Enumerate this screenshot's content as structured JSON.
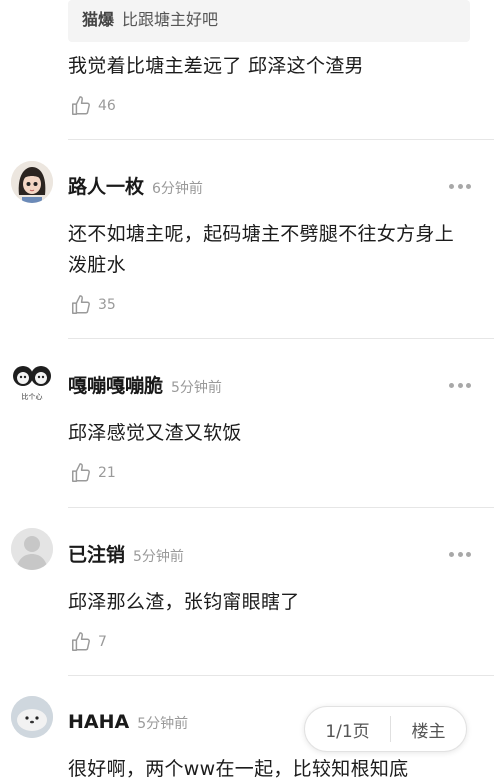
{
  "quote": {
    "author": "猫爆",
    "text": "比跟塘主好吧"
  },
  "top_comment": {
    "text": "我觉着比塘主差远了 邱泽这个渣男",
    "likes": "46"
  },
  "comments": [
    {
      "author": "路人一枚",
      "time": "6分钟前",
      "text": "还不如塘主呢，起码塘主不劈腿不往女方身上泼脏水",
      "likes": "35",
      "avatar": "cartoon-girl-avatar"
    },
    {
      "author": "嘎嘣嘎嘣脆",
      "time": "5分钟前",
      "text": "邱泽感觉又渣又软饭",
      "likes": "21",
      "avatar": "cartoon-faces-avatar",
      "avatar_caption": "比个心"
    },
    {
      "author": "已注销",
      "time": "5分钟前",
      "text": "邱泽那么渣，张钧甯眼瞎了",
      "likes": "7",
      "avatar": "default-user-avatar"
    },
    {
      "author": "HAHA",
      "time": "5分钟前",
      "text": "很好啊，两个ww在一起，比较知根知底",
      "avatar": "seal-avatar"
    }
  ],
  "pager": {
    "page": "1/1页",
    "op_label": "楼主"
  },
  "colors": {
    "divider": "#e6e6e6",
    "muted": "#9a9a9a",
    "quote_bg": "#f4f4f4"
  }
}
